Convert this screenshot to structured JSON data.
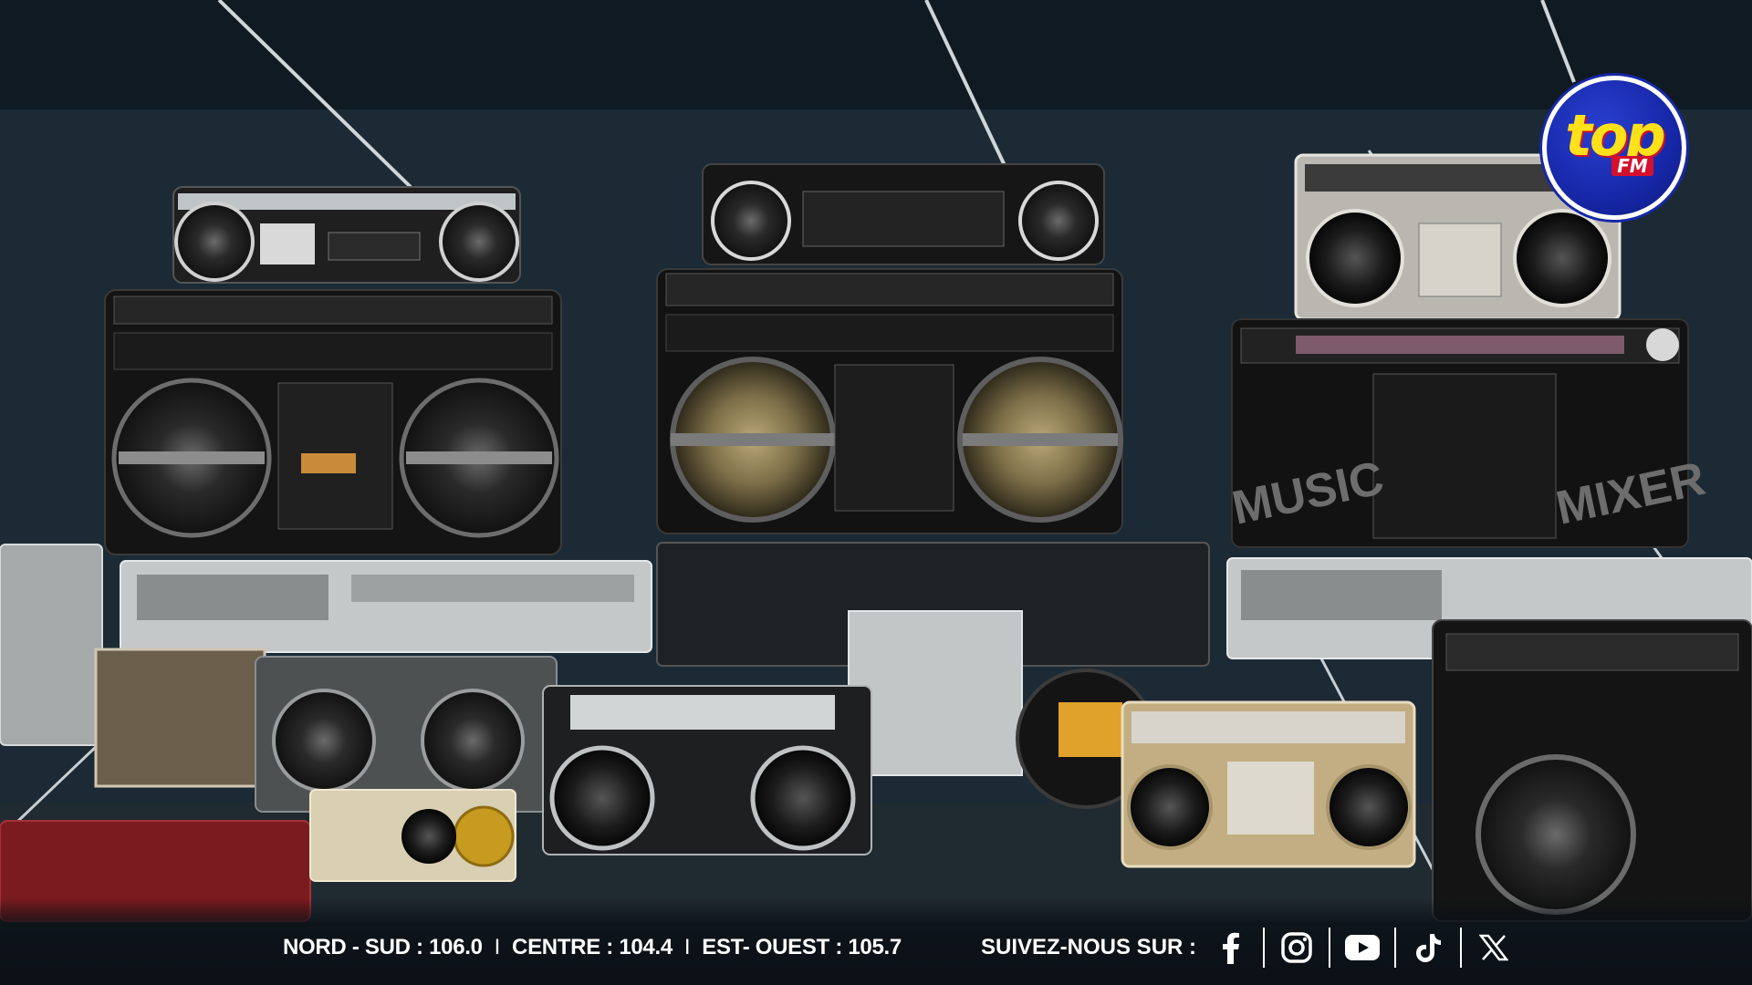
{
  "logo": {
    "text": "top",
    "sub": "FM",
    "colors": {
      "ring": "#1627a8",
      "text": "#ffe11a",
      "badge": "#d4102e"
    }
  },
  "frequencies": {
    "items": [
      {
        "label": "NORD - SUD : 106.0"
      },
      {
        "label": "CENTRE : 104.4"
      },
      {
        "label": "EST- OUEST : 105.7"
      }
    ],
    "separator": "I"
  },
  "follow": {
    "label": "SUIVEZ-NOUS SUR :"
  },
  "socials": [
    {
      "name": "facebook-icon"
    },
    {
      "name": "instagram-icon"
    },
    {
      "name": "youtube-icon"
    },
    {
      "name": "tiktok-icon"
    },
    {
      "name": "x-icon"
    }
  ],
  "photo": {
    "labels": {
      "left": "MUSIC",
      "right": "MIXER"
    }
  }
}
